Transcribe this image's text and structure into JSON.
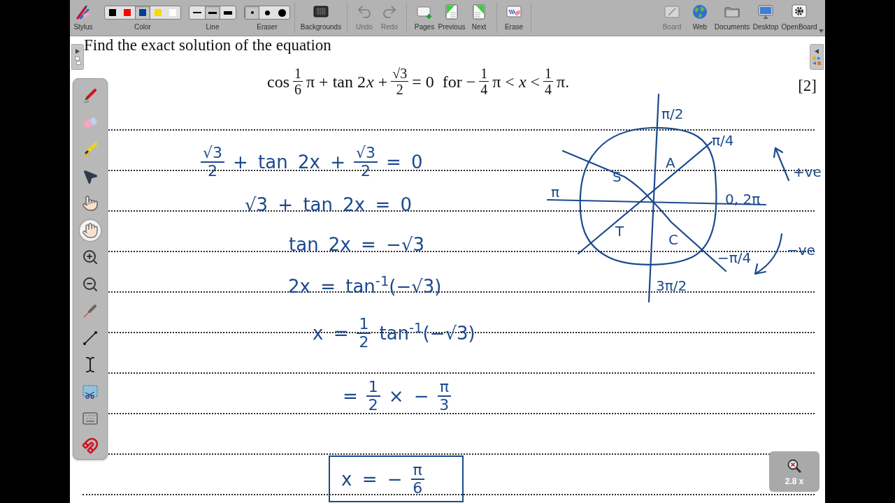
{
  "toolbar": {
    "groups": [
      [
        {
          "kind": "button",
          "label": "Stylus",
          "disabled": false
        },
        {
          "kind": "colors",
          "label": "Color",
          "options": [
            {
              "color": "#000000",
              "selected": false
            },
            {
              "color": "#ff0000",
              "selected": false
            },
            {
              "color": "#003f8f",
              "selected": true
            },
            {
              "color": "#ffd800",
              "selected": false
            },
            {
              "color": "#ffffff",
              "selected": false
            }
          ]
        },
        {
          "kind": "lines",
          "label": "Line",
          "options": [
            {
              "selected": false
            },
            {
              "selected": true
            },
            {
              "selected": false
            }
          ]
        },
        {
          "kind": "eraser",
          "label": "Eraser",
          "options": [
            {
              "selected": true
            },
            {
              "selected": false
            },
            {
              "selected": false
            }
          ]
        }
      ],
      [
        {
          "kind": "button",
          "label": "Backgrounds",
          "disabled": false
        }
      ],
      [
        {
          "kind": "button",
          "label": "Undo",
          "disabled": true
        },
        {
          "kind": "button",
          "label": "Redo",
          "disabled": true
        }
      ],
      [
        {
          "kind": "button",
          "label": "Pages",
          "disabled": false
        },
        {
          "kind": "button",
          "label": "Previous",
          "disabled": false
        },
        {
          "kind": "button",
          "label": "Next",
          "disabled": false
        }
      ],
      [
        {
          "kind": "button",
          "label": "Erase",
          "disabled": false
        }
      ]
    ],
    "right_items": [
      {
        "label": "Board",
        "disabled": true
      },
      {
        "label": "Web",
        "disabled": false
      },
      {
        "label": "Documents",
        "disabled": false
      },
      {
        "label": "Desktop",
        "disabled": false
      },
      {
        "label": "OpenBoard",
        "disabled": false
      }
    ]
  },
  "tools": [
    {
      "selected": false
    },
    {
      "selected": false
    },
    {
      "selected": false
    },
    {
      "selected": false
    },
    {
      "selected": false
    },
    {
      "selected": true
    },
    {
      "selected": false
    },
    {
      "selected": false
    },
    {
      "selected": false
    },
    {
      "selected": false
    },
    {
      "selected": false
    },
    {
      "selected": false
    },
    {
      "selected": false
    },
    {
      "selected": false
    }
  ],
  "question": {
    "prompt": "Find the exact solution of the equation",
    "equation": [
      {
        "kind": "text",
        "text": "cos"
      },
      {
        "kind": "frac",
        "num": "1",
        "den": "6"
      },
      {
        "kind": "text",
        "text": "π + tan 2"
      },
      {
        "kind": "var",
        "text": "x"
      },
      {
        "kind": "text",
        "text": "+"
      },
      {
        "kind": "frac",
        "num": "√3",
        "den": "2"
      },
      {
        "kind": "text",
        "text": "= 0  for −"
      },
      {
        "kind": "frac",
        "num": "1",
        "den": "4"
      },
      {
        "kind": "text",
        "text": "π < *x* <"
      },
      {
        "kind": "frac",
        "num": "1",
        "den": "4"
      },
      {
        "kind": "text",
        "text": "π."
      }
    ],
    "marks": "[2]"
  },
  "working": [
    {
      "boxed": false,
      "parts": [
        {
          "kind": "frac",
          "num": "√3",
          "den": "2"
        },
        {
          "kind": "text",
          "text": "+ tan 2x +"
        },
        {
          "kind": "frac",
          "num": "√3",
          "den": "2"
        },
        {
          "kind": "text",
          "text": "= 0"
        }
      ]
    },
    {
      "boxed": false,
      "parts": [
        {
          "kind": "text",
          "text": "√3 + tan 2x = 0"
        }
      ]
    },
    {
      "boxed": false,
      "parts": [
        {
          "kind": "text",
          "text": "tan 2x = −√3"
        }
      ]
    },
    {
      "boxed": false,
      "parts": [
        {
          "kind": "text",
          "text": "2x = tan$^{-1}$(−√3)"
        }
      ]
    },
    {
      "boxed": false,
      "parts": [
        {
          "kind": "text",
          "text": "x ="
        },
        {
          "kind": "frac",
          "num": "1",
          "den": "2"
        },
        {
          "kind": "text",
          "text": "tan$^{-1}$(−√3)"
        }
      ]
    },
    {
      "boxed": false,
      "parts": [
        {
          "kind": "text",
          "text": "="
        },
        {
          "kind": "frac",
          "num": "1",
          "den": "2"
        },
        {
          "kind": "text",
          "text": "× −"
        },
        {
          "kind": "frac",
          "num": "π",
          "den": "3"
        }
      ]
    },
    {
      "boxed": true,
      "parts": [
        {
          "kind": "text",
          "text": "x = −"
        },
        {
          "kind": "frac",
          "num": "π",
          "den": "6"
        }
      ]
    }
  ],
  "diagram": {
    "labels": [
      "π/2",
      "π/4",
      "A",
      "S",
      "π",
      "0, 2π",
      "T",
      "C",
      "−π/4",
      "3π/2",
      "+ve",
      "−ve"
    ]
  },
  "zoom_indicator": {
    "label": "2.8 x"
  }
}
